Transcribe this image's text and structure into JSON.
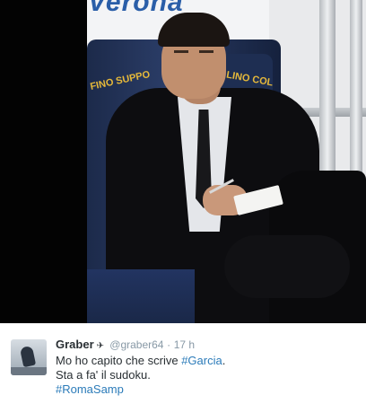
{
  "photo": {
    "banner_text": "Verona",
    "sponsor_left": "FINO SUPPO",
    "sponsor_right": "LINO COL"
  },
  "tweet": {
    "user_name": "Graber",
    "user_icon": "pin-icon",
    "handle": "@graber64",
    "separator": "·",
    "timestamp": "17 h",
    "line1_text": "Mo ho capito che scrive ",
    "line1_hashtag": "#Garcia",
    "line1_end": ".",
    "line2_text": "Sta a fa' il sudoku.",
    "line3_hashtag": "#RomaSamp"
  },
  "colors": {
    "hashtag": "#2b7bb9",
    "meta": "#8899a6",
    "text": "#292f33"
  }
}
